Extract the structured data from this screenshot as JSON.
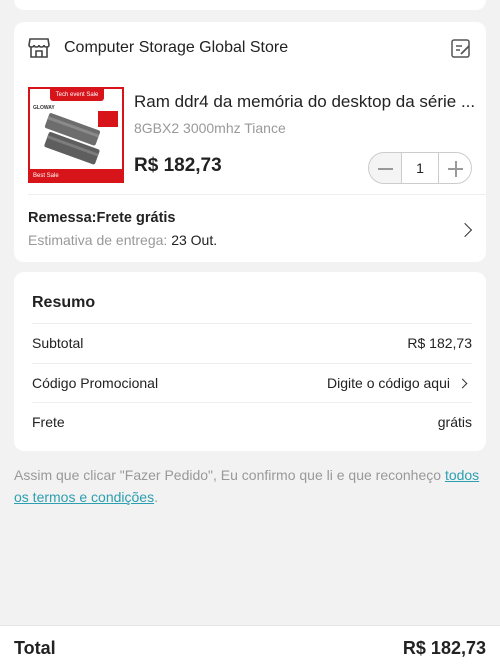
{
  "store": {
    "name": "Computer Storage Global Store"
  },
  "product": {
    "thumb_banner": "Tech event Sale",
    "thumb_logo": "GLOWAY",
    "thumb_bottom": "Best Sale",
    "title": "Ram ddr4 da memória do desktop da série ...",
    "variant": "8GBX2 3000mhz Tiance",
    "price": "R$ 182,73",
    "quantity": "1"
  },
  "shipping": {
    "title": "Remessa:Frete grátis",
    "eta_label": "Estimativa de entrega: ",
    "eta_date": "23 Out."
  },
  "summary": {
    "title": "Resumo",
    "rows": [
      {
        "label": "Subtotal",
        "value": "R$ 182,73"
      },
      {
        "label": "Código Promocional",
        "value": "Digite o código aqui"
      },
      {
        "label": "Frete",
        "value": "grátis"
      }
    ]
  },
  "terms": {
    "text": "Assim que clicar \"Fazer Pedido\", Eu confirmo que li e que reconheço ",
    "link": "todos os termos e condições",
    "suffix": "."
  },
  "footer": {
    "total_label": "Total",
    "total_value": "R$ 182,73"
  },
  "colors": {
    "accent_link": "#2c9fb0",
    "thumb_red": "#d7141a"
  }
}
